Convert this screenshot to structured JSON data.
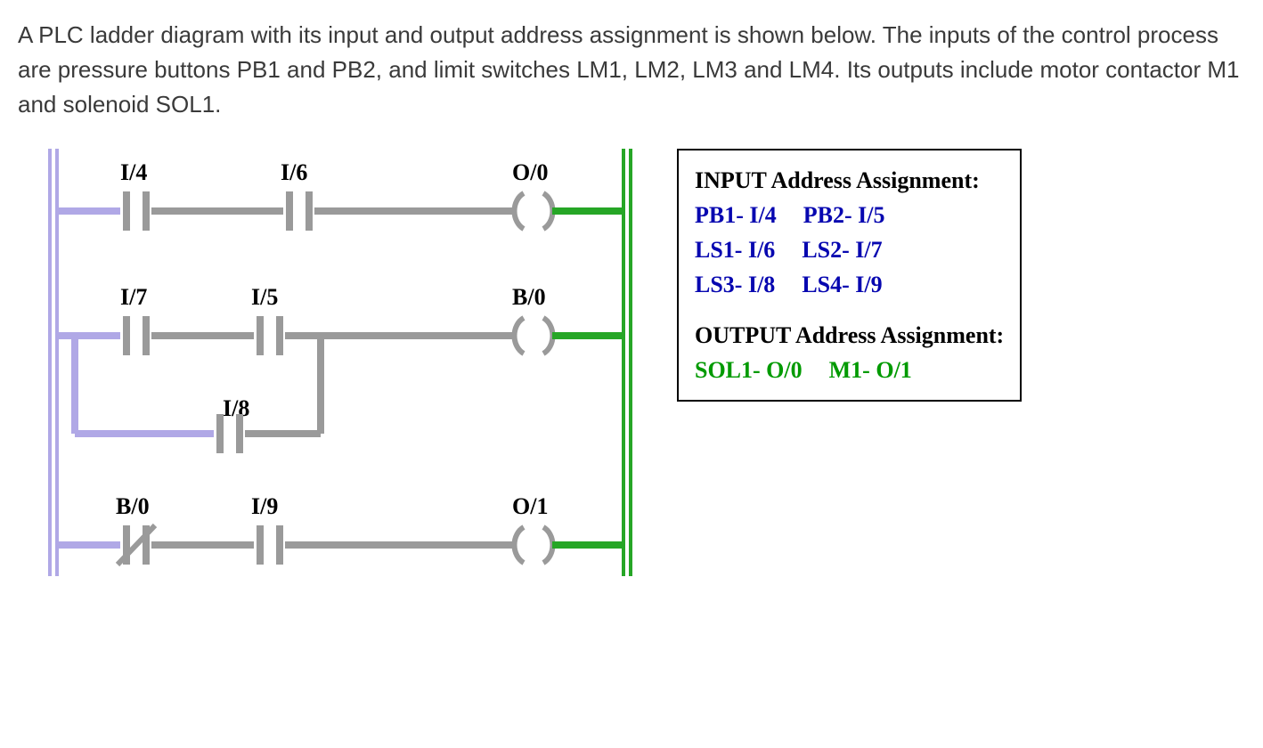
{
  "description": "A PLC ladder diagram with its input and output address assignment is shown below. The inputs of the control process are pressure buttons PB1 and PB2, and limit switches LM1, LM2, LM3 and LM4. Its outputs include motor contactor M1 and solenoid SOL1.",
  "ladder": {
    "rung1": {
      "contact1": "I/4",
      "contact2": "I/6",
      "output": "O/0"
    },
    "rung2": {
      "contact1": "I/7",
      "contact2": "I/5",
      "branch": "I/8",
      "output": "B/0"
    },
    "rung3": {
      "contact1_nc": "B/0",
      "contact2": "I/9",
      "output": "O/1"
    }
  },
  "assignment": {
    "input_heading": "INPUT Address Assignment:",
    "inputs": {
      "pb1": "PB1-  I/4",
      "pb2": "PB2-  I/5",
      "ls1": "LS1-  I/6",
      "ls2": "LS2-  I/7",
      "ls3": "LS3-  I/8",
      "ls4": "LS4-  I/9"
    },
    "output_heading": "OUTPUT Address Assignment:",
    "outputs": {
      "sol1": "SOL1-  O/0",
      "m1": "M1-  O/1"
    }
  }
}
